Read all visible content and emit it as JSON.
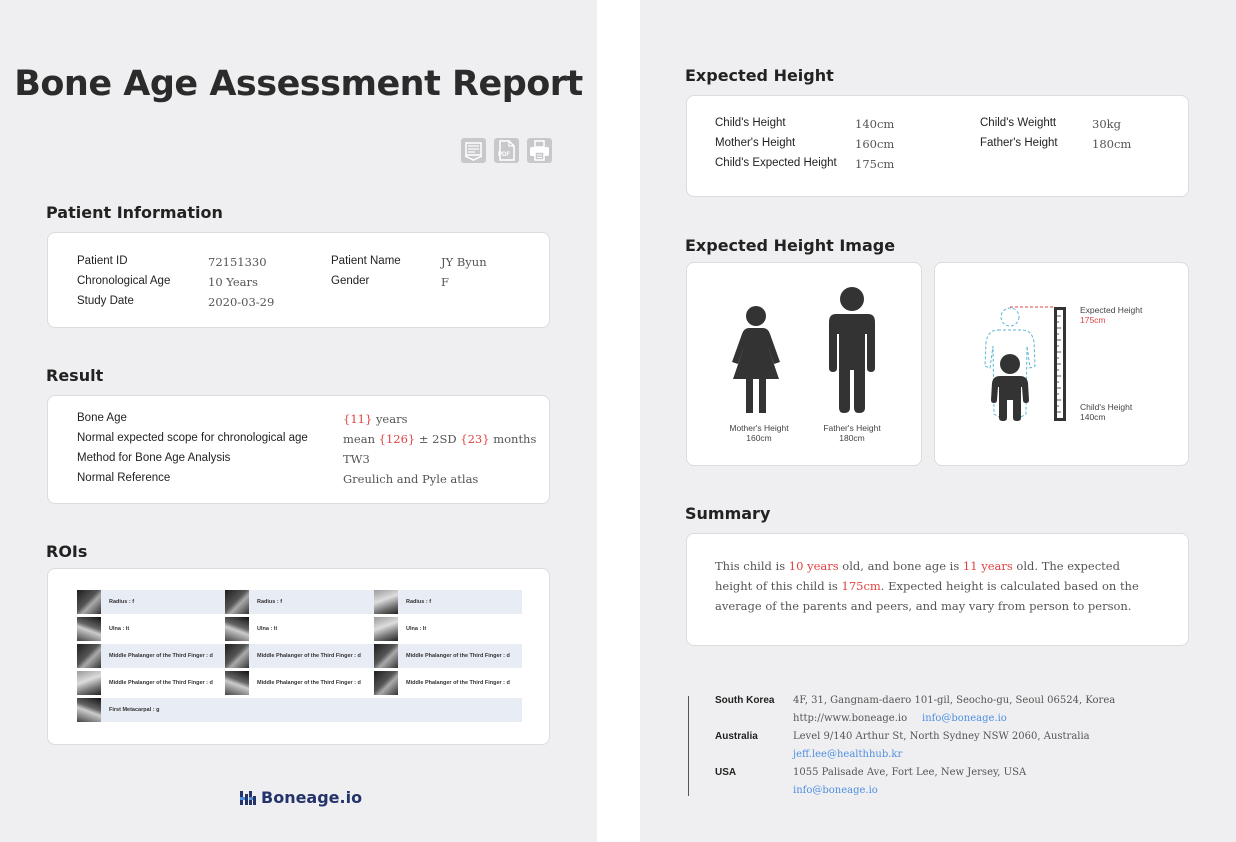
{
  "report": {
    "title": "Bone Age Assessment Report",
    "toolbar": {
      "pdf_label": "PDF"
    }
  },
  "patient": {
    "heading": "Patient Information",
    "id_label": "Patient ID",
    "id_value": "72151330",
    "name_label": "Patient Name",
    "name_value": "JY Byun",
    "age_label": "Chronological Age",
    "age_value": "10 Years",
    "gender_label": "Gender",
    "gender_value": "F",
    "date_label": "Study Date",
    "date_value": "2020-03-29"
  },
  "result": {
    "heading": "Result",
    "bone_age_label": "Bone Age",
    "bone_age_value": "{11}",
    "bone_age_unit": "years",
    "scope_label": "Normal expected scope for chronological age",
    "scope_prefix": "mean",
    "scope_mean": "{126}",
    "scope_mid": "± 2SD",
    "scope_sd": "{23}",
    "scope_unit": "months",
    "method_label": "Method for Bone Age Analysis",
    "method_value": "TW3",
    "reference_label": "Normal Reference",
    "reference_value": "Greulich and Pyle atlas"
  },
  "rois": {
    "heading": "ROIs",
    "rows": [
      [
        "Radius : f",
        "Radius : f",
        "Radius : f"
      ],
      [
        "Ulna : lt",
        "Ulna : lt",
        "Ulna : lt"
      ],
      [
        "Middle Phalanger of the Third Finger : d",
        "Middle Phalanger of the Third Finger : d",
        "Middle Phalanger of the Third Finger : d"
      ],
      [
        "Middle Phalanger of the Third Finger : d",
        "Middle Phalanger of the Third Finger : d",
        "Middle Phalanger of the Third Finger : d"
      ],
      [
        "First Metacarpal : g"
      ]
    ]
  },
  "brand": {
    "name": "Boneage.io",
    "color": "#24346b"
  },
  "expected_height": {
    "heading": "Expected Height",
    "child_height_label": "Child's Height",
    "child_height_value": "140cm",
    "child_weight_label": "Child's Weightt",
    "child_weight_value": "30kg",
    "mother_height_label": "Mother's Height",
    "mother_height_value": "160cm",
    "father_height_label": "Father's Height",
    "father_height_value": "180cm",
    "expected_label": "Child's Expected Height",
    "expected_value": "175cm"
  },
  "height_image": {
    "heading": "Expected Height Image",
    "mother_caption": "Mother's Height",
    "mother_value": "160cm",
    "father_caption": "Father's Height",
    "father_value": "180cm",
    "expected_caption": "Expected Height",
    "expected_value": "175cm",
    "child_caption": "Child's Height",
    "child_value": "140cm",
    "accent_color": "#e04343",
    "dashed_color": "#5bb6d6"
  },
  "summary": {
    "heading": "Summary",
    "p1": "This child is ",
    "age": "10 years",
    "p2": " old, and bone age is ",
    "bone_age": "11 years",
    "p3": " old. The expected height of this child is ",
    "height": "175cm",
    "p4": ". Expected height is calculated based on the average of the parents and peers, and may vary from person to person."
  },
  "footer": {
    "korea_label": "South Korea",
    "korea_address": "4F, 31, Gangnam-daero 101-gil, Seocho-gu, Seoul 06524, Korea",
    "korea_web": "http://www.boneage.io",
    "korea_email": "info@boneage.io",
    "australia_label": "Australia",
    "australia_address": "Level 9/140 Arthur St, North Sydney NSW 2060, Australia",
    "australia_email": "jeff.lee@healthhub.kr",
    "usa_label": "USA",
    "usa_address": "1055 Palisade Ave, Fort Lee, New Jersey, USA",
    "usa_email": "info@boneage.io"
  }
}
